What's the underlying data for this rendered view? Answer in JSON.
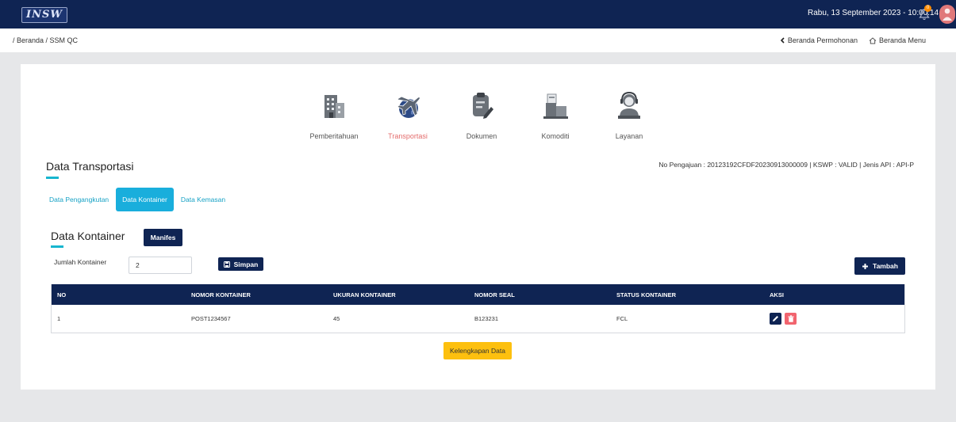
{
  "header": {
    "logo_text": "INSW",
    "datetime": "Rabu, 13 September 2023 - 10:00:14",
    "notification_count": "0"
  },
  "breadcrumb": {
    "path": "/ Beranda / SSM QC",
    "links": [
      "Beranda Permohonan",
      "Beranda Menu"
    ]
  },
  "steps": [
    {
      "label": "Pemberitahuan",
      "icon": "building-icon",
      "active": false
    },
    {
      "label": "Transportasi",
      "icon": "plane-globe-icon",
      "active": true
    },
    {
      "label": "Dokumen",
      "icon": "document-edit-icon",
      "active": false
    },
    {
      "label": "Komoditi",
      "icon": "boxes-icon",
      "active": false
    },
    {
      "label": "Layanan",
      "icon": "support-agent-icon",
      "active": false
    }
  ],
  "section": {
    "title": "Data Transportasi",
    "pengajuan_info": "No Pengajuan : 20123192CFDF20230913000009 | KSWP : VALID | Jenis API : API-P"
  },
  "tabs": [
    "Data Pengangkutan",
    "Data Kontainer",
    "Data Kemasan"
  ],
  "kontainer": {
    "title": "Data Kontainer",
    "manifes_label": "Manifes",
    "jumlah_label": "Jumlah Kontainer",
    "jumlah_value": "2",
    "simpan_label": "Simpan",
    "tambah_label": "Tambah",
    "columns": [
      "NO",
      "NOMOR KONTAINER",
      "UKURAN KONTAINER",
      "NOMOR SEAL",
      "STATUS KONTAINER",
      "AKSI"
    ],
    "rows": [
      {
        "no": "1",
        "nomor": "POST1234567",
        "ukuran": "45",
        "seal": "B123231",
        "status": "FCL"
      }
    ],
    "kelengkapan_label": "Kelengkapan Data"
  },
  "colors": {
    "navy": "#0f2453",
    "accent_cyan": "#19aedc",
    "active_red": "#e46c6c",
    "delete_red": "#f1646e",
    "yellow": "#fdc00f"
  }
}
